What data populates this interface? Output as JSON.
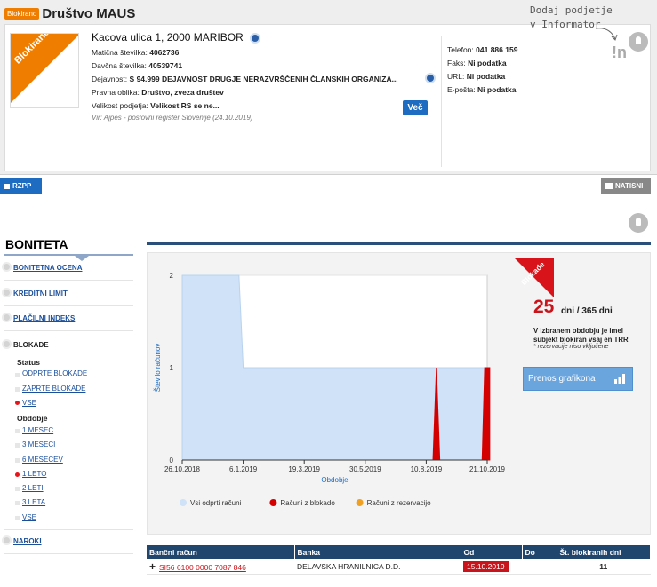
{
  "header": {
    "status_tag": "Blokirano",
    "company_name": "Društvo MAUS",
    "logo_ribbon": "Blokirano",
    "address": "Kacova ulica 1, 2000 MARIBOR",
    "fields": [
      {
        "label": "Matična številka:",
        "value": "4062736"
      },
      {
        "label": "Davčna številka:",
        "value": "40539741"
      },
      {
        "label": "Dejavnost:",
        "value": "S 94.999 DEJAVNOST DRUGJE NERAZVRŠČENIH ČLANSKIH ORGANIZA..."
      },
      {
        "label": "Pravna oblika:",
        "value": "Društvo, zveza društev"
      },
      {
        "label": "Velikost podjetja:",
        "value": "Velikost RS se ne..."
      }
    ],
    "source_note": "Vir: Ajpes - poslovni register Slovenije (24.10.2019)",
    "vec_button": "Več",
    "contacts": [
      {
        "label": "Telefon:",
        "value": "041 886 159"
      },
      {
        "label": "Faks:",
        "value": "Ni podatka"
      },
      {
        "label": "URL:",
        "value": "Ni podatka"
      },
      {
        "label": "E-pošta:",
        "value": "Ni podatka"
      }
    ],
    "informator_line1": "Dodaj podjetje",
    "informator_line2": "v Informator",
    "informator_logo": "!n"
  },
  "toolbar": {
    "rzpp_label": "RZPP",
    "print_label": "NATISNI"
  },
  "sidebar": {
    "title": "BONITETA",
    "items": [
      {
        "label": "BONITETNA OCENA"
      },
      {
        "label": "KREDITNI LIMIT"
      },
      {
        "label": "PLAČILNI INDEKS"
      },
      {
        "label": "BLOKADE"
      },
      {
        "label": "NAROKI"
      }
    ],
    "status_heading": "Status",
    "status_options": [
      {
        "label": "ODPRTE BLOKADE",
        "active": false
      },
      {
        "label": "ZAPRTE BLOKADE",
        "active": false
      },
      {
        "label": "VSE",
        "active": true
      }
    ],
    "period_heading": "Obdobje",
    "period_options": [
      {
        "label": "1 MESEC",
        "active": false
      },
      {
        "label": "3 MESECI",
        "active": false
      },
      {
        "label": "6 MESECEV",
        "active": false
      },
      {
        "label": "1 LETO",
        "active": true
      },
      {
        "label": "2 LETI",
        "active": false
      },
      {
        "label": "3 LETA",
        "active": false
      },
      {
        "label": "VSE",
        "active": false
      }
    ]
  },
  "blokade": {
    "ribbon": "Blokade",
    "days": "25",
    "days_of": "dni / 365 dni",
    "description": "V izbranem obdobju je imel subjekt blokiran vsaj en TRR",
    "note": "* rezervacije niso vključene",
    "download_button": "Prenos grafikona"
  },
  "chart_data": {
    "type": "area",
    "xlabel": "Obdobje",
    "ylabel": "Število računov",
    "ylim": [
      0,
      2
    ],
    "yticks": [
      "0",
      "1",
      "2"
    ],
    "xticks": [
      "26.10.2018",
      "6.1.2019",
      "19.3.2019",
      "30.5.2019",
      "10.8.2019",
      "21.10.2019"
    ],
    "series": [
      {
        "name": "Vsi odprti računi",
        "color": "#cfe2f7",
        "points": [
          [
            "26.10.2018",
            2
          ],
          [
            "1.1.2019",
            2
          ],
          [
            "6.1.2019",
            1
          ],
          [
            "24.10.2019",
            1
          ]
        ]
      },
      {
        "name": "Računi z blokado",
        "color": "#d40000",
        "points": [
          [
            "18.8.2019",
            0
          ],
          [
            "22.8.2019",
            1
          ],
          [
            "26.8.2019",
            0
          ],
          [
            "15.10.2019",
            0
          ],
          [
            "18.10.2019",
            1
          ],
          [
            "24.10.2019",
            1
          ]
        ]
      },
      {
        "name": "Računi z rezervacijo",
        "color": "#f0a020",
        "points": []
      }
    ]
  },
  "bank_table": {
    "headers": [
      "Bančni račun",
      "Banka",
      "Od",
      "Do",
      "Št. blokiranih dni"
    ],
    "rows": [
      {
        "account": "SI56 6100 0000 7087 846",
        "bank": "DELAVSKA HRANILNICA D.D.",
        "from": "15.10.2019",
        "to": "",
        "days": "11"
      }
    ]
  }
}
